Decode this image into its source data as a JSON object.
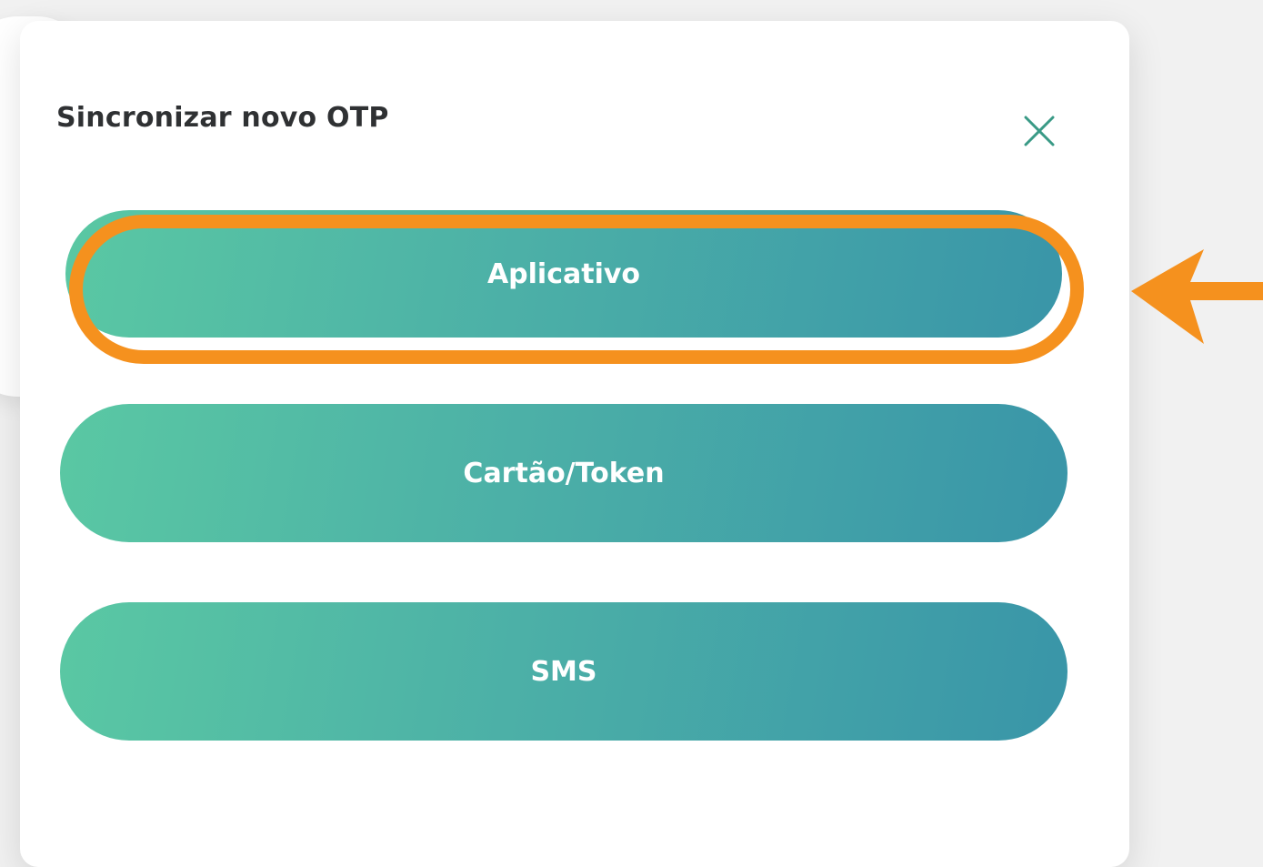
{
  "modal": {
    "title": "Sincronizar novo OTP",
    "close_icon": "close-icon"
  },
  "options": [
    {
      "label": "Aplicativo"
    },
    {
      "label": "Cartão/Token"
    },
    {
      "label": "SMS"
    }
  ],
  "annotation": {
    "highlight_color": "#f5911e",
    "arrow_icon": "arrow-left-icon"
  },
  "colors": {
    "background": "#f1f1f1",
    "button_gradient_start": "#5ac8a3",
    "button_gradient_end": "#3995a8",
    "close_icon": "#3a9a86",
    "title": "#2f3133"
  }
}
